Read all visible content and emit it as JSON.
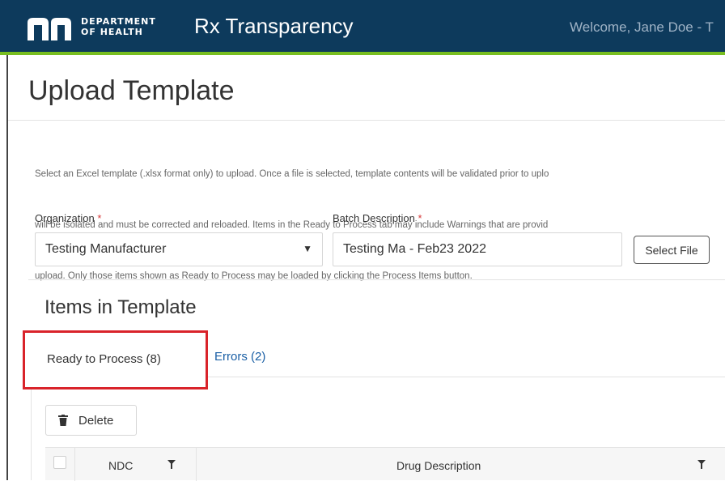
{
  "header": {
    "logo_letters": "mn",
    "logo_line1": "DEPARTMENT",
    "logo_line2": "OF HEALTH",
    "app_title": "Rx Transparency",
    "welcome": "Welcome, Jane Doe - T"
  },
  "page": {
    "title": "Upload Template",
    "description_lines": [
      "Select an Excel template (.xlsx format only) to upload. Once a file is selected, template contents will be validated prior to uplo",
      "will be isolated and must be corrected and reloaded. Items in the Ready to Process tab may include Warnings that are provid",
      "upload. Only those items shown as Ready to Process may be loaded by clicking the Process Items button."
    ]
  },
  "form": {
    "organization_label": "Organization",
    "organization_value": "Testing Manufacturer",
    "batch_label": "Batch Description",
    "batch_value": "Testing Ma - Feb23 2022",
    "required_mark": "*",
    "select_file_label": "Select File"
  },
  "items": {
    "title": "Items in Template",
    "tabs": [
      {
        "label": "Ready to Process (8)",
        "active": true
      },
      {
        "label": "Errors (2)",
        "active": false
      }
    ],
    "delete_label": "Delete",
    "columns": [
      "NDC",
      "Drug Description"
    ]
  },
  "colors": {
    "header_bg": "#0d3a5c",
    "header_accent": "#78be20",
    "highlight_box": "#d9232a",
    "link": "#1a5fa5",
    "required": "#d63a3a"
  },
  "icons": [
    "trash-icon",
    "filter-icon",
    "dropdown-caret-icon",
    "checkbox-icon"
  ]
}
